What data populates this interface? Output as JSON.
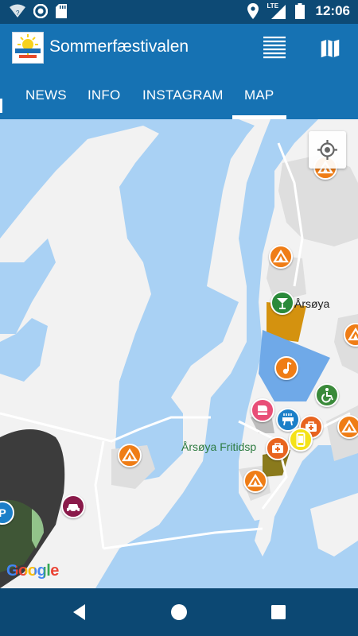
{
  "status_bar": {
    "time": "12:06",
    "network": "LTE",
    "icons": [
      "wifi-icon",
      "radio-icon",
      "sd-card-icon",
      "location-icon",
      "signal-icon",
      "battery-icon"
    ]
  },
  "app_bar": {
    "title": "Sommerfæstivalen",
    "logo_text": "SOMMERFÆSTIVALEN",
    "icons": [
      "menu-icon",
      "map-icon"
    ]
  },
  "tabs": [
    {
      "label": "NEWS"
    },
    {
      "label": "INFO"
    },
    {
      "label": "INSTAGRAM"
    },
    {
      "label": "MAP",
      "selected": true
    }
  ],
  "map": {
    "labels": {
      "island": "Årsøya",
      "center": "Årsøya Fritidsp"
    },
    "attribution": "Google",
    "markers": [
      "camping",
      "camping",
      "bar",
      "camping",
      "music",
      "accessibility",
      "piano",
      "bbq",
      "first-aid",
      "phone",
      "camping",
      "first-aid",
      "camping",
      "camping",
      "taxi",
      "parking"
    ],
    "colors": {
      "water": "#a9d1f4",
      "land": "#f2f2f2",
      "camping": "#ef7d16",
      "bar": "#2a8a3a",
      "taxi": "#8a1a4a",
      "accessibility": "#3a8a3a"
    }
  },
  "nav_bar": {
    "buttons": [
      "back",
      "home",
      "recents"
    ]
  }
}
